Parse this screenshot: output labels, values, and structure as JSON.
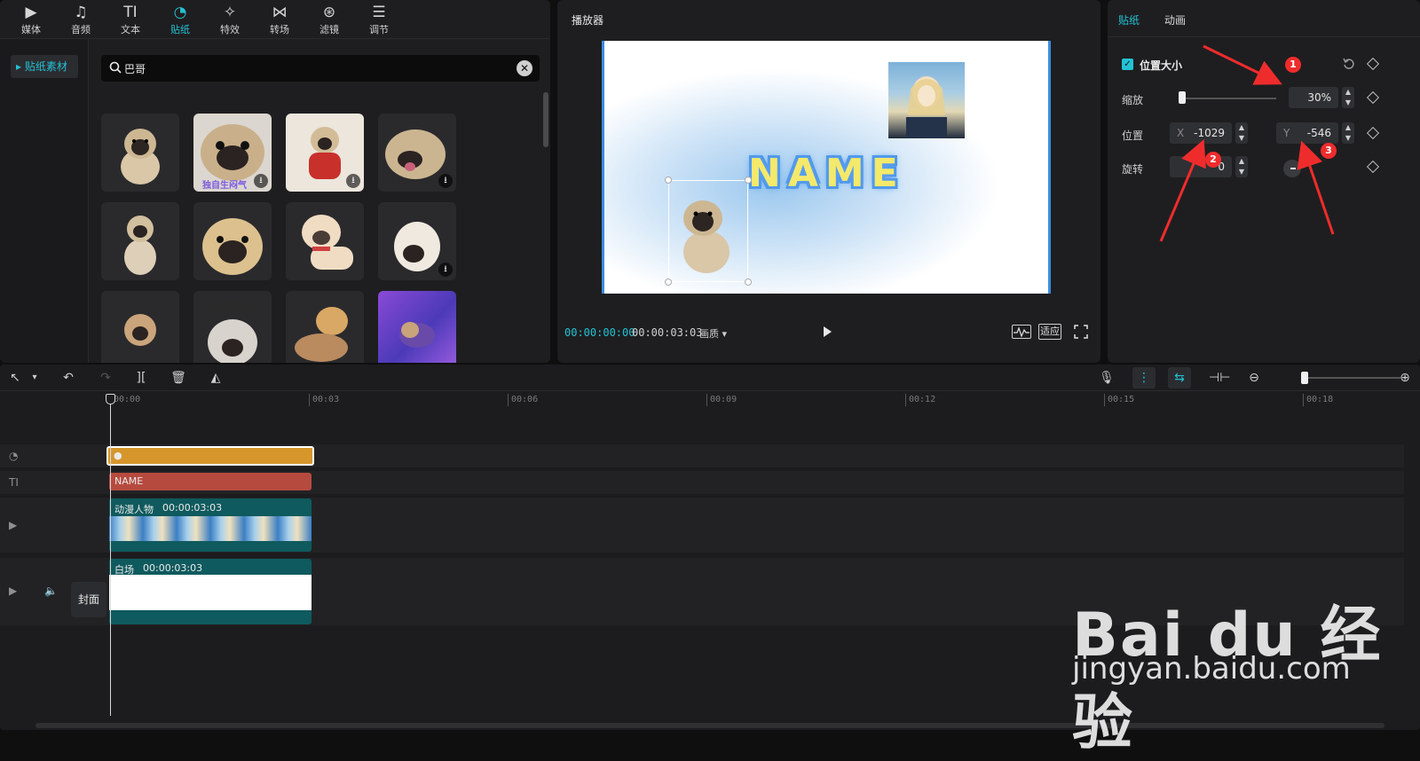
{
  "toolbar": {
    "categories": [
      {
        "label": "媒体",
        "icon": "media-icon"
      },
      {
        "label": "音频",
        "icon": "audio-icon"
      },
      {
        "label": "文本",
        "icon": "text-icon"
      },
      {
        "label": "贴纸",
        "icon": "sticker-icon",
        "active": true
      },
      {
        "label": "特效",
        "icon": "effects-icon"
      },
      {
        "label": "转场",
        "icon": "transition-icon"
      },
      {
        "label": "滤镜",
        "icon": "filter-icon"
      },
      {
        "label": "调节",
        "icon": "adjust-icon"
      }
    ],
    "icon_glyphs": [
      "▶",
      "♫",
      "TI",
      "◔",
      "✧",
      "⋈",
      "⊛",
      "☰"
    ]
  },
  "library": {
    "side_item": "贴纸素材",
    "search_value": "巴哥",
    "sticker_thumb_text": "独自生闷气"
  },
  "player": {
    "title": "播放器",
    "canvas_text": "NAME",
    "current_time": "00:00:00:00",
    "total_time": "00:00:03:03",
    "quality_label": "画质",
    "fit_label": "适应"
  },
  "properties": {
    "tabs": [
      "贴纸",
      "动画"
    ],
    "section": "位置大小",
    "scale_label": "缩放",
    "scale_value": "30%",
    "scale_fraction": 0.0,
    "position_label": "位置",
    "x_prefix": "X",
    "x_value": "-1029",
    "y_prefix": "Y",
    "y_value": "-546",
    "rotate_label": "旋转",
    "rotate_value": "0",
    "annotations": [
      "1",
      "2",
      "3"
    ],
    "annotation_color": "#ef2c2c"
  },
  "timeline": {
    "ruler": [
      "00:00",
      "00:03",
      "00:06",
      "00:09",
      "00:12",
      "00:15",
      "00:18"
    ],
    "tracks": {
      "text_clip": "NAME",
      "video_clip_label": "动漫人物",
      "video_clip_duration": "00:00:03:03",
      "bg_clip_label": "白场",
      "bg_clip_duration": "00:00:03:03",
      "cover_label": "封面"
    }
  },
  "watermark": {
    "logo_text": "Bai du 经验",
    "url": "jingyan.baidu.com"
  },
  "colors": {
    "accent": "#23c2d4",
    "sticker_clip": "#d6962c",
    "text_clip": "#b74a3f",
    "video_clip": "#0f5a5e"
  }
}
